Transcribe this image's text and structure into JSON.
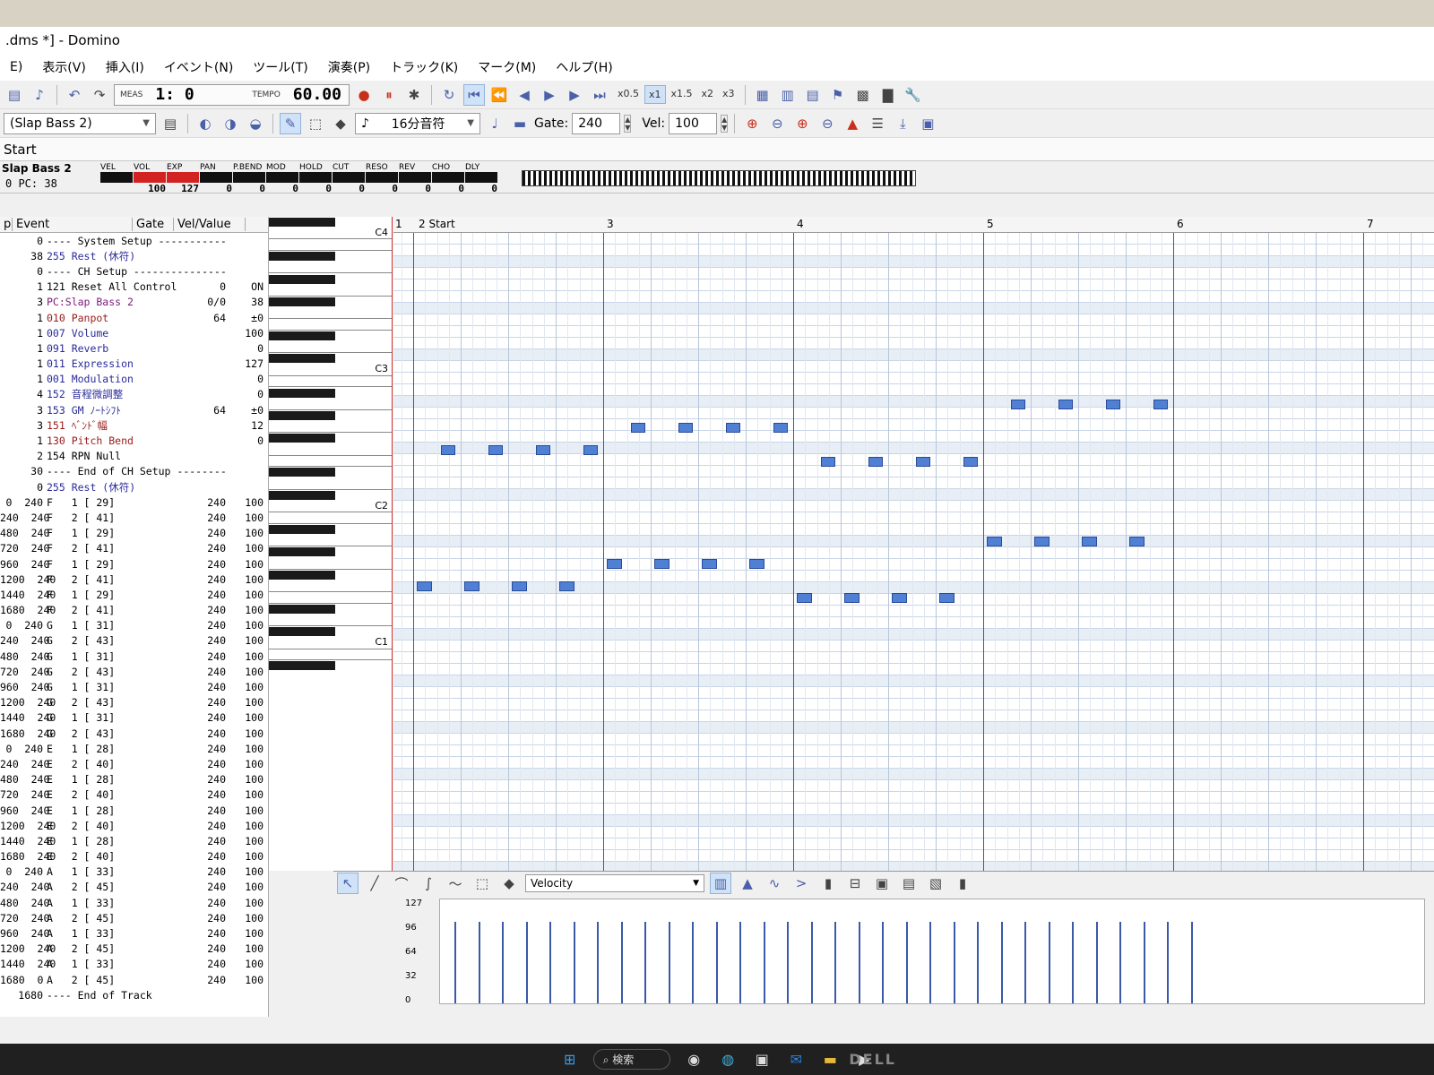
{
  "window": {
    "title": ".dms *] - Domino"
  },
  "menu": [
    "E)",
    "表示(V)",
    "挿入(I)",
    "イベント(N)",
    "ツール(T)",
    "演奏(P)",
    "トラック(K)",
    "マーク(M)",
    "ヘルプ(H)"
  ],
  "toolbar": {
    "meas_label": "MEAS",
    "meas_value": "1:    0",
    "tempo_label": "TEMPO",
    "tempo_value": "60.00",
    "speeds": [
      "x0.5",
      "x1",
      "x1.5",
      "x2",
      "x3"
    ],
    "active_speed": "x1"
  },
  "toolbar2": {
    "instrument": "(Slap Bass 2)",
    "note_length": "16分音符",
    "gate_label": "Gate:",
    "gate_value": "240",
    "vel_label": "Vel:",
    "vel_value": "100"
  },
  "tab": {
    "label": "Start"
  },
  "mixer": {
    "track_name": "Slap Bass 2",
    "track_pc": "0 PC: 38",
    "knobs": [
      {
        "label": "VEL",
        "value": ""
      },
      {
        "label": "VOL",
        "value": "100"
      },
      {
        "label": "EXP",
        "value": "127"
      },
      {
        "label": "PAN",
        "value": "0"
      },
      {
        "label": "P.BEND",
        "value": "0"
      },
      {
        "label": "MOD",
        "value": "0"
      },
      {
        "label": "HOLD",
        "value": "0"
      },
      {
        "label": "CUT",
        "value": "0"
      },
      {
        "label": "RESO",
        "value": "0"
      },
      {
        "label": "REV",
        "value": "0"
      },
      {
        "label": "CHO",
        "value": "0"
      },
      {
        "label": "DLY",
        "value": "0"
      }
    ]
  },
  "event_list": {
    "headers": [
      "p",
      "Event",
      "Gate",
      "Vel/Value"
    ],
    "rows": [
      {
        "t": "0",
        "ev": "---- System Setup -----------",
        "g": "",
        "v": "",
        "k": "sys"
      },
      {
        "t": "38",
        "ev": "255 Rest (休符)",
        "g": "",
        "v": "",
        "k": "rest"
      },
      {
        "t": "0",
        "ev": "---- CH Setup ---------------",
        "g": "",
        "v": "",
        "k": "sys"
      },
      {
        "t": "1",
        "ev": "121 Reset All Control",
        "g": "0",
        "v": "ON",
        "k": "sys"
      },
      {
        "t": "3",
        "ev": "PC:Slap Bass 2",
        "g": "0/0",
        "v": "38",
        "k": "pc"
      },
      {
        "t": "1",
        "ev": "010 Panpot",
        "g": "64",
        "v": "±0",
        "k": "pb"
      },
      {
        "t": "1",
        "ev": "007 Volume",
        "g": "",
        "v": "100",
        "k": "ctl"
      },
      {
        "t": "1",
        "ev": "091 Reverb",
        "g": "",
        "v": "0",
        "k": "ctl"
      },
      {
        "t": "1",
        "ev": "011 Expression",
        "g": "",
        "v": "127",
        "k": "ctl"
      },
      {
        "t": "1",
        "ev": "001 Modulation",
        "g": "",
        "v": "0",
        "k": "ctl"
      },
      {
        "t": "4",
        "ev": "152 音程微調整",
        "g": "",
        "v": "0",
        "k": "ctl"
      },
      {
        "t": "3",
        "ev": "153 GM ﾉｰﾄｼﾌﾄ",
        "g": "64",
        "v": "±0",
        "k": "ctl"
      },
      {
        "t": "3",
        "ev": "151 ﾍﾞﾝﾄﾞ幅",
        "g": "",
        "v": "12",
        "k": "pb"
      },
      {
        "t": "1",
        "ev": "130 Pitch Bend",
        "g": "",
        "v": "0",
        "k": "pb"
      },
      {
        "t": "2",
        "ev": "154 RPN Null",
        "g": "",
        "v": "",
        "k": "sys"
      },
      {
        "t": "30",
        "ev": "---- End of CH Setup --------",
        "g": "",
        "v": "",
        "k": "sys"
      },
      {
        "t": "0",
        "ev": "255 Rest (休符)",
        "g": "",
        "v": "",
        "k": "rest"
      },
      {
        "t": "0  240",
        "ev": "F   1 [ 29]",
        "g": "240",
        "v": "100",
        "k": "n"
      },
      {
        "t": "240  240",
        "ev": "F   2 [ 41]",
        "g": "240",
        "v": "100",
        "k": "n"
      },
      {
        "t": "480  240",
        "ev": "F   1 [ 29]",
        "g": "240",
        "v": "100",
        "k": "n"
      },
      {
        "t": "720  240",
        "ev": "F   2 [ 41]",
        "g": "240",
        "v": "100",
        "k": "n"
      },
      {
        "t": "960  240",
        "ev": "F   1 [ 29]",
        "g": "240",
        "v": "100",
        "k": "n"
      },
      {
        "t": "1200  240",
        "ev": "F   2 [ 41]",
        "g": "240",
        "v": "100",
        "k": "n"
      },
      {
        "t": "1440  240",
        "ev": "F   1 [ 29]",
        "g": "240",
        "v": "100",
        "k": "n"
      },
      {
        "t": "1680  240",
        "ev": "F   2 [ 41]",
        "g": "240",
        "v": "100",
        "k": "n"
      },
      {
        "t": "0  240",
        "ev": "G   1 [ 31]",
        "g": "240",
        "v": "100",
        "k": "n"
      },
      {
        "t": "240  240",
        "ev": "G   2 [ 43]",
        "g": "240",
        "v": "100",
        "k": "n"
      },
      {
        "t": "480  240",
        "ev": "G   1 [ 31]",
        "g": "240",
        "v": "100",
        "k": "n"
      },
      {
        "t": "720  240",
        "ev": "G   2 [ 43]",
        "g": "240",
        "v": "100",
        "k": "n"
      },
      {
        "t": "960  240",
        "ev": "G   1 [ 31]",
        "g": "240",
        "v": "100",
        "k": "n"
      },
      {
        "t": "1200  240",
        "ev": "G   2 [ 43]",
        "g": "240",
        "v": "100",
        "k": "n"
      },
      {
        "t": "1440  240",
        "ev": "G   1 [ 31]",
        "g": "240",
        "v": "100",
        "k": "n"
      },
      {
        "t": "1680  240",
        "ev": "G   2 [ 43]",
        "g": "240",
        "v": "100",
        "k": "n"
      },
      {
        "t": "0  240",
        "ev": "E   1 [ 28]",
        "g": "240",
        "v": "100",
        "k": "n"
      },
      {
        "t": "240  240",
        "ev": "E   2 [ 40]",
        "g": "240",
        "v": "100",
        "k": "n"
      },
      {
        "t": "480  240",
        "ev": "E   1 [ 28]",
        "g": "240",
        "v": "100",
        "k": "n"
      },
      {
        "t": "720  240",
        "ev": "E   2 [ 40]",
        "g": "240",
        "v": "100",
        "k": "n"
      },
      {
        "t": "960  240",
        "ev": "E   1 [ 28]",
        "g": "240",
        "v": "100",
        "k": "n"
      },
      {
        "t": "1200  240",
        "ev": "E   2 [ 40]",
        "g": "240",
        "v": "100",
        "k": "n"
      },
      {
        "t": "1440  240",
        "ev": "E   1 [ 28]",
        "g": "240",
        "v": "100",
        "k": "n"
      },
      {
        "t": "1680  240",
        "ev": "E   2 [ 40]",
        "g": "240",
        "v": "100",
        "k": "n"
      },
      {
        "t": "0  240",
        "ev": "A   1 [ 33]",
        "g": "240",
        "v": "100",
        "k": "n"
      },
      {
        "t": "240  240",
        "ev": "A   2 [ 45]",
        "g": "240",
        "v": "100",
        "k": "n"
      },
      {
        "t": "480  240",
        "ev": "A   1 [ 33]",
        "g": "240",
        "v": "100",
        "k": "n"
      },
      {
        "t": "720  240",
        "ev": "A   2 [ 45]",
        "g": "240",
        "v": "100",
        "k": "n"
      },
      {
        "t": "960  240",
        "ev": "A   1 [ 33]",
        "g": "240",
        "v": "100",
        "k": "n"
      },
      {
        "t": "1200  240",
        "ev": "A   2 [ 45]",
        "g": "240",
        "v": "100",
        "k": "n"
      },
      {
        "t": "1440  240",
        "ev": "A   1 [ 33]",
        "g": "240",
        "v": "100",
        "k": "n"
      },
      {
        "t": "1680  0",
        "ev": "A   2 [ 45]",
        "g": "240",
        "v": "100",
        "k": "n"
      },
      {
        "t": "1680",
        "ev": "---- End of Track",
        "g": "",
        "v": "",
        "k": "sys"
      }
    ]
  },
  "piano": {
    "octave_labels": [
      "C4",
      "C3",
      "C2",
      "C1"
    ]
  },
  "roll": {
    "measure_labels": [
      "1",
      "2 Start",
      "3",
      "4",
      "5",
      "6",
      "7"
    ],
    "notes": [
      {
        "meas": 2,
        "step": 0,
        "pitch": 29
      },
      {
        "meas": 2,
        "step": 1,
        "pitch": 41
      },
      {
        "meas": 2,
        "step": 2,
        "pitch": 29
      },
      {
        "meas": 2,
        "step": 3,
        "pitch": 41
      },
      {
        "meas": 2,
        "step": 4,
        "pitch": 29
      },
      {
        "meas": 2,
        "step": 5,
        "pitch": 41
      },
      {
        "meas": 2,
        "step": 6,
        "pitch": 29
      },
      {
        "meas": 2,
        "step": 7,
        "pitch": 41
      },
      {
        "meas": 3,
        "step": 0,
        "pitch": 31
      },
      {
        "meas": 3,
        "step": 1,
        "pitch": 43
      },
      {
        "meas": 3,
        "step": 2,
        "pitch": 31
      },
      {
        "meas": 3,
        "step": 3,
        "pitch": 43
      },
      {
        "meas": 3,
        "step": 4,
        "pitch": 31
      },
      {
        "meas": 3,
        "step": 5,
        "pitch": 43
      },
      {
        "meas": 3,
        "step": 6,
        "pitch": 31
      },
      {
        "meas": 3,
        "step": 7,
        "pitch": 43
      },
      {
        "meas": 4,
        "step": 0,
        "pitch": 28
      },
      {
        "meas": 4,
        "step": 1,
        "pitch": 40
      },
      {
        "meas": 4,
        "step": 2,
        "pitch": 28
      },
      {
        "meas": 4,
        "step": 3,
        "pitch": 40
      },
      {
        "meas": 4,
        "step": 4,
        "pitch": 28
      },
      {
        "meas": 4,
        "step": 5,
        "pitch": 40
      },
      {
        "meas": 4,
        "step": 6,
        "pitch": 28
      },
      {
        "meas": 4,
        "step": 7,
        "pitch": 40
      },
      {
        "meas": 5,
        "step": 0,
        "pitch": 33
      },
      {
        "meas": 5,
        "step": 1,
        "pitch": 45
      },
      {
        "meas": 5,
        "step": 2,
        "pitch": 33
      },
      {
        "meas": 5,
        "step": 3,
        "pitch": 45
      },
      {
        "meas": 5,
        "step": 4,
        "pitch": 33
      },
      {
        "meas": 5,
        "step": 5,
        "pitch": 45
      },
      {
        "meas": 5,
        "step": 6,
        "pitch": 33
      },
      {
        "meas": 5,
        "step": 7,
        "pitch": 45
      }
    ]
  },
  "velocity_pane": {
    "mode": "Velocity",
    "axis_labels": [
      "127",
      "96",
      "64",
      "32",
      "0"
    ],
    "value": 100,
    "count": 32
  },
  "taskbar": {
    "search": "検索",
    "brand": "DELL"
  }
}
